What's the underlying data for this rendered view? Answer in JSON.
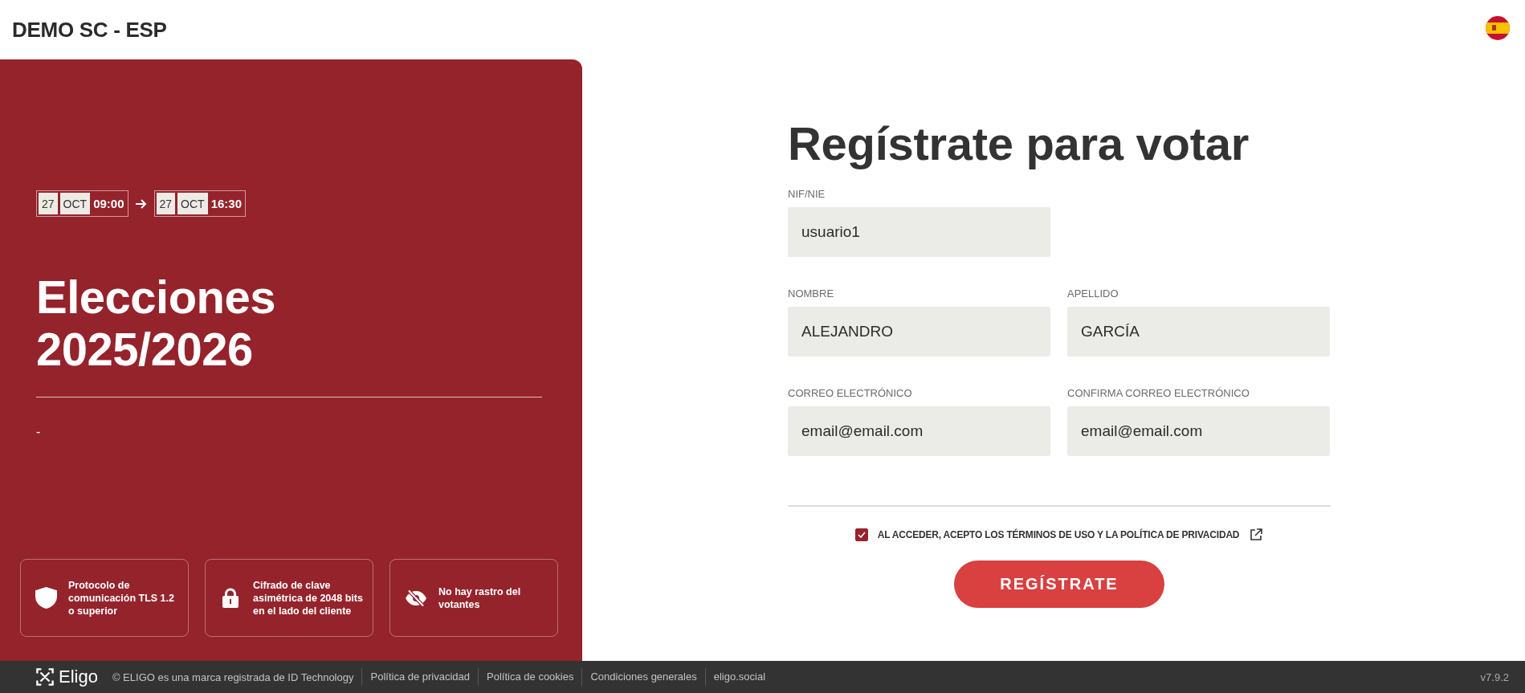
{
  "header": {
    "title": "DEMO SC - ESP"
  },
  "event": {
    "dates": [
      {
        "day": "27",
        "month": "OCT",
        "time": "09:00"
      },
      {
        "day": "27",
        "month": "OCT",
        "time": "16:30"
      }
    ],
    "title": "Elecciones 2025/2026",
    "description": "-"
  },
  "features": [
    {
      "kind": "shield",
      "text": "Protocolo de comunicación TLS 1.2 o superior"
    },
    {
      "kind": "lock",
      "text": "Cifrado de clave asimétrica de 2048 bits en el lado del cliente"
    },
    {
      "kind": "eye-off",
      "text": "No hay rastro del votantes"
    }
  ],
  "form": {
    "title": "Regístrate para votar",
    "rows": [
      [
        {
          "label": "NIF/NIE",
          "value": "usuario1"
        }
      ],
      [
        {
          "label": "NOMBRE",
          "value": "ALEJANDRO"
        },
        {
          "label": "APELLIDO",
          "value": "GARCÍA"
        }
      ],
      [
        {
          "label": "CORREO ELECTRÓNICO",
          "value": "email@email.com"
        },
        {
          "label": "CONFIRMA CORREO ELECTRÓNICO",
          "value": "email@email.com"
        }
      ]
    ],
    "terms": {
      "checked": true,
      "text": "AL ACCEDER, ACEPTO LOS TÉRMINOS DE USO Y LA POLÍTICA DE PRIVACIDAD"
    },
    "submit": "REGÍSTRATE"
  },
  "footer": {
    "brand": "Eligo",
    "copyright": "© ELIGO es una marca registrada de ID Technology",
    "links": [
      "Política de privacidad",
      "Política de cookies",
      "Condiciones generales",
      "eligo.social"
    ],
    "version": "v7.9.2"
  }
}
